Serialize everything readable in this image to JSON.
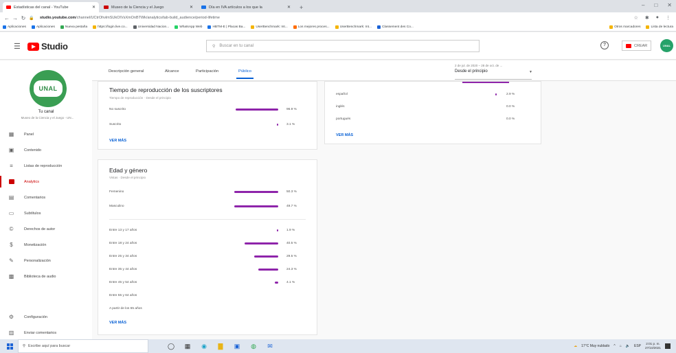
{
  "browser": {
    "tabs": [
      {
        "label": "Estadísticas del canal - YouTube",
        "color": "#ff0000",
        "active": true
      },
      {
        "label": "Museo de la Ciencia y el Juego",
        "color": "#cc0000",
        "active": false
      },
      {
        "label": "Día en IVA artículos a los que la",
        "color": "#1a73e8",
        "active": false
      }
    ],
    "new_tab": "+",
    "url_domain": "studio.youtube.com",
    "url_path": "/channel/UCtrOhvlmSUkOIVsXmOnBTWk/analytics/tab-build_audience/period-lifetime",
    "bookmarks": [
      "Aplicaciones",
      "Aplicaciones",
      "Nueva pestaña",
      "https://login.live.co...",
      "Universidad Nacion...",
      "WhatsApp Web",
      "HBTM-E | Placas Ba...",
      "UserBenchmark: Int...",
      "Los mejores proces...",
      "UserBenchmark: Int...",
      "Classement des Co..."
    ],
    "bookmarks_right": [
      "Otros marcadores",
      "Lista de lectura"
    ]
  },
  "header": {
    "logo_text": "Studio",
    "search_placeholder": "Buscar en tu canal",
    "create_label": "CREAR",
    "help": "?",
    "avatar_text": "UNAL"
  },
  "sidebar": {
    "logo_text": "UNAL",
    "channel_title": "Tu canal",
    "channel_name": "Museo de la Ciencia y el Juego - UN...",
    "items": [
      {
        "label": "Panel",
        "icon": "dashboard-icon"
      },
      {
        "label": "Contenido",
        "icon": "content-icon"
      },
      {
        "label": "Listas de reproducción",
        "icon": "playlist-icon"
      },
      {
        "label": "Analytics",
        "icon": "analytics-icon",
        "active": true
      },
      {
        "label": "Comentarios",
        "icon": "comments-icon"
      },
      {
        "label": "Subtítulos",
        "icon": "subtitles-icon"
      },
      {
        "label": "Derechos de autor",
        "icon": "copyright-icon"
      },
      {
        "label": "Monetización",
        "icon": "monetization-icon"
      },
      {
        "label": "Personalización",
        "icon": "customization-icon"
      },
      {
        "label": "Biblioteca de audio",
        "icon": "audio-library-icon"
      }
    ],
    "bottom": [
      {
        "label": "Configuración",
        "icon": "gear-icon"
      },
      {
        "label": "Enviar comentarios",
        "icon": "feedback-icon"
      }
    ]
  },
  "analytics_tabs": [
    "Descripción general",
    "Alcance",
    "Participación",
    "Público"
  ],
  "date_range": {
    "range": "2 de jul. de 2020 – 28 de oct. de ...",
    "label": "Desde el principio"
  },
  "subscribers_card": {
    "title": "Tiempo de reproducción de los suscriptores",
    "subtitle": "Tiempo de reproducción · Desde el principio",
    "rows": [
      {
        "label": "No suscrito",
        "value": 96.9,
        "text": "96.9 %"
      },
      {
        "label": "Suscrito",
        "value": 3.1,
        "text": "3.1 %"
      }
    ],
    "more": "VER MÁS"
  },
  "languages_card": {
    "rows": [
      {
        "label": "español",
        "value": 2.9,
        "text": "2.9 %"
      },
      {
        "label": "inglés",
        "value": 0.0,
        "text": "0.0 %"
      },
      {
        "label": "portugués",
        "value": 0.0,
        "text": "0.0 %"
      }
    ],
    "more": "VER MÁS"
  },
  "age_gender_card": {
    "title": "Edad y género",
    "subtitle": "Vistas · Desde el principio",
    "gender": [
      {
        "label": "Femenino",
        "value": 50.3,
        "text": "50.3 %"
      },
      {
        "label": "Masculino",
        "value": 49.7,
        "text": "49.7 %"
      }
    ],
    "ages": [
      {
        "label": "Entre 13 y 17 años",
        "value": 1.9,
        "text": "1.9 %"
      },
      {
        "label": "Entre 18 y 24 años",
        "value": 40.5,
        "text": "40.5 %"
      },
      {
        "label": "Entre 25 y 34 años",
        "value": 29.5,
        "text": "29.5 %"
      },
      {
        "label": "Entre 35 y 44 años",
        "value": 24.3,
        "text": "24.3 %"
      },
      {
        "label": "Entre 45 y 54 años",
        "value": 4.1,
        "text": "4.1 %"
      },
      {
        "label": "Entre 55 y 64 años",
        "value": null,
        "text": ""
      },
      {
        "label": "A partir de los 65 años",
        "value": null,
        "text": ""
      }
    ],
    "more": "VER MÁS"
  },
  "taskbar": {
    "search_placeholder": "Escribe aquí para buscar",
    "weather": "17°C Muy nublado",
    "lang": "ESP",
    "time": "2:01 p. m.",
    "date": "27/10/2021"
  },
  "colors": {
    "accent": "#065fd4",
    "bar": "#8e24aa",
    "brand": "#ff0000"
  }
}
